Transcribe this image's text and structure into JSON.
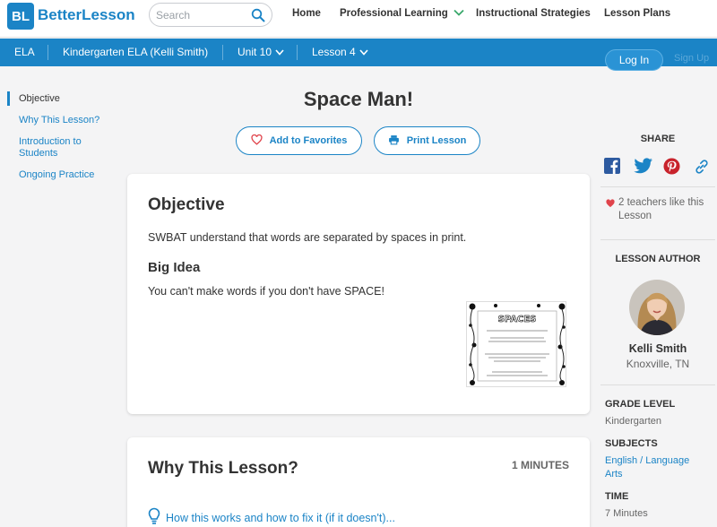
{
  "header": {
    "logo_mark": "BL",
    "logo_text": "BetterLesson",
    "search_placeholder": "Search",
    "nav": [
      "Home",
      "Professional Learning",
      "Instructional Strategies",
      "Lesson Plans"
    ]
  },
  "breadcrumb": {
    "subject": "ELA",
    "course": "Kindergarten ELA (Kelli Smith)",
    "unit": "Unit 10",
    "lesson": "Lesson 4"
  },
  "auth": {
    "login": "Log In",
    "signup": "Sign Up"
  },
  "toc": [
    "Objective",
    "Why This Lesson?",
    "Introduction to Students",
    "Ongoing Practice"
  ],
  "lesson": {
    "title": "Space Man!",
    "add_favorites": "Add to Favorites",
    "print": "Print Lesson"
  },
  "objective_card": {
    "heading": "Objective",
    "text": "SWBAT understand that words are separated by spaces in print.",
    "big_idea_heading": "Big Idea",
    "big_idea_text": "You can't make words if you don't have SPACE!",
    "thumb_title": "SPACES"
  },
  "why_card": {
    "heading": "Why This Lesson?",
    "minutes": "1 MINUTES",
    "help_link": "How this works and how to fix it (if it doesn't)..."
  },
  "sidebar": {
    "share_label": "SHARE",
    "share_icons": [
      "facebook-icon",
      "twitter-icon",
      "pinterest-icon",
      "link-icon"
    ],
    "likes": "2 teachers like this Lesson",
    "author_label": "LESSON AUTHOR",
    "author_name": "Kelli Smith",
    "author_location": "Knoxville, TN",
    "grade_label": "GRADE LEVEL",
    "grade_value": "Kindergarten",
    "subjects_label": "SUBJECTS",
    "subjects_value": "English / Language Arts",
    "time_label": "TIME",
    "time_value": "7 Minutes"
  },
  "colors": {
    "brand_blue": "#1b84c6",
    "heart_red": "#e0434b",
    "green_chevron": "#3aa86b"
  }
}
